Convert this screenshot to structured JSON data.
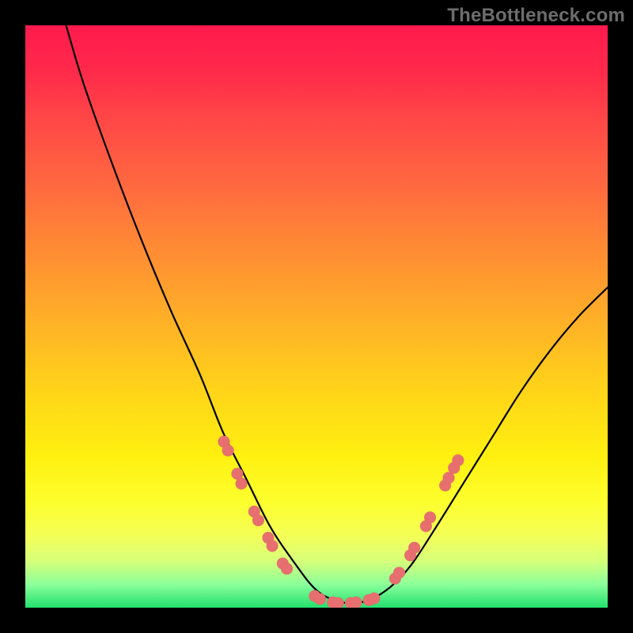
{
  "watermark": "TheBottleneck.com",
  "chart_data": {
    "type": "line",
    "title": "",
    "xlabel": "",
    "ylabel": "",
    "xlim": [
      0,
      100
    ],
    "ylim": [
      0,
      100
    ],
    "grid": false,
    "legend": false,
    "series": [
      {
        "name": "bottleneck-curve",
        "x": [
          7,
          10,
          15,
          20,
          25,
          30,
          34,
          38,
          42,
          46,
          50,
          54,
          58,
          62,
          66,
          70,
          75,
          80,
          85,
          90,
          95,
          100
        ],
        "y": [
          100,
          90,
          76,
          63,
          51,
          40,
          30,
          22,
          14,
          8,
          3,
          1,
          1,
          3,
          7,
          13,
          21,
          29,
          37,
          44,
          50,
          55
        ],
        "color": "#000000"
      }
    ],
    "markers": [
      {
        "name": "left-cluster-points",
        "color": "#e76f6f",
        "points": [
          {
            "x": 34.1,
            "y": 28.5
          },
          {
            "x": 34.8,
            "y": 27.0
          },
          {
            "x": 36.4,
            "y": 23.0
          },
          {
            "x": 37.1,
            "y": 21.3
          },
          {
            "x": 39.3,
            "y": 16.5
          },
          {
            "x": 40.0,
            "y": 15.0
          },
          {
            "x": 41.7,
            "y": 12.0
          },
          {
            "x": 42.4,
            "y": 10.6
          },
          {
            "x": 44.2,
            "y": 7.6
          },
          {
            "x": 44.9,
            "y": 6.7
          }
        ]
      },
      {
        "name": "valley-points",
        "color": "#e76f6f",
        "points": [
          {
            "x": 49.7,
            "y": 2.0
          },
          {
            "x": 50.6,
            "y": 1.5
          },
          {
            "x": 52.8,
            "y": 0.9
          },
          {
            "x": 53.7,
            "y": 0.8
          },
          {
            "x": 55.9,
            "y": 0.8
          },
          {
            "x": 56.8,
            "y": 0.9
          },
          {
            "x": 59.0,
            "y": 1.3
          },
          {
            "x": 59.9,
            "y": 1.6
          }
        ]
      },
      {
        "name": "right-cluster-points",
        "color": "#e76f6f",
        "points": [
          {
            "x": 63.5,
            "y": 5.0
          },
          {
            "x": 64.2,
            "y": 6.0
          },
          {
            "x": 66.1,
            "y": 9.0
          },
          {
            "x": 66.8,
            "y": 10.3
          },
          {
            "x": 68.8,
            "y": 14.0
          },
          {
            "x": 69.5,
            "y": 15.5
          },
          {
            "x": 72.1,
            "y": 21.0
          },
          {
            "x": 72.7,
            "y": 22.3
          },
          {
            "x": 73.6,
            "y": 24.0
          },
          {
            "x": 74.3,
            "y": 25.3
          }
        ]
      }
    ]
  }
}
